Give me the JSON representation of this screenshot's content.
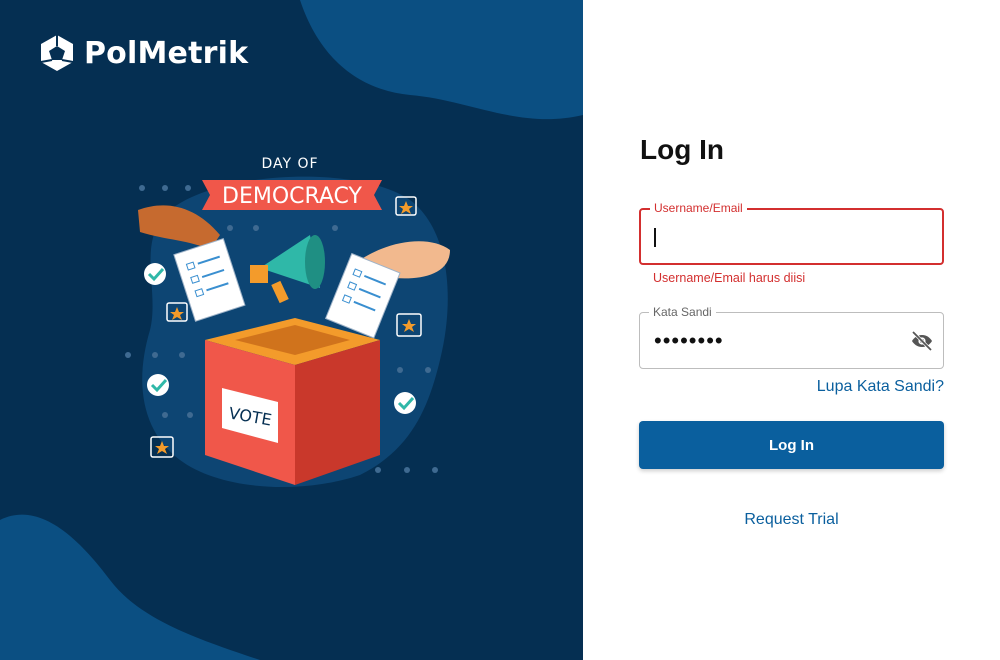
{
  "brand": {
    "name": "PolMetrik",
    "logo_icon": "cube-logo-icon"
  },
  "illustration": {
    "heading_small": "DAY OF",
    "heading_ribbon": "DEMOCRACY",
    "box_label": "VOTE",
    "colors": {
      "panel": "#052f52",
      "ribbon": "#f0574a",
      "box": "#e84b3c",
      "accent_teal": "#2fb8a8",
      "star": "#f39b2b"
    }
  },
  "login": {
    "title": "Log In",
    "username": {
      "label": "Username/Email",
      "value": "",
      "error": "Username/Email harus diisi"
    },
    "password": {
      "label": "Kata Sandi",
      "masked_value": "••••••••",
      "toggle_icon": "eye-off-icon"
    },
    "forgot_label": "Lupa Kata Sandi?",
    "submit_label": "Log In",
    "trial_label": "Request Trial"
  },
  "colors": {
    "primary": "#0a5f9e",
    "error": "#d32f2f"
  }
}
